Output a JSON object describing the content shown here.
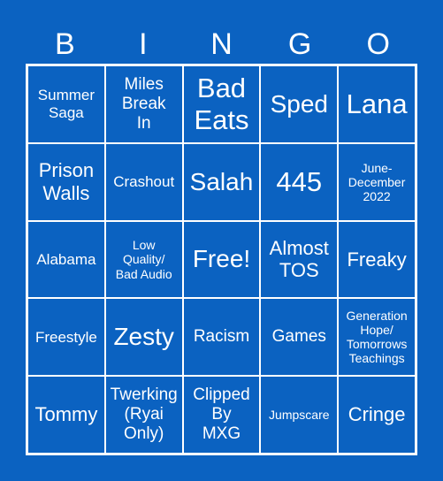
{
  "header": [
    "B",
    "I",
    "N",
    "G",
    "O"
  ],
  "cells": [
    [
      "Summer\nSaga",
      "Miles\nBreak\nIn",
      "Bad\nEats",
      "Sped",
      "Lana"
    ],
    [
      "Prison\nWalls",
      "Crashout",
      "Salah",
      "445",
      "June-\nDecember\n2022"
    ],
    [
      "Alabama",
      "Low\nQuality/\nBad Audio",
      "Free!",
      "Almost\nTOS",
      "Freaky"
    ],
    [
      "Freestyle",
      "Zesty",
      "Racism",
      "Games",
      "Generation\nHope/\nTomorrows\nTeachings"
    ],
    [
      "Tommy",
      "Twerking\n(Ryai\nOnly)",
      "Clipped\nBy\nMXG",
      "Jumpscare",
      "Cringe"
    ]
  ],
  "colors": {
    "background": "#0b62c1",
    "text": "#ffffff",
    "grid": "#ffffff"
  }
}
